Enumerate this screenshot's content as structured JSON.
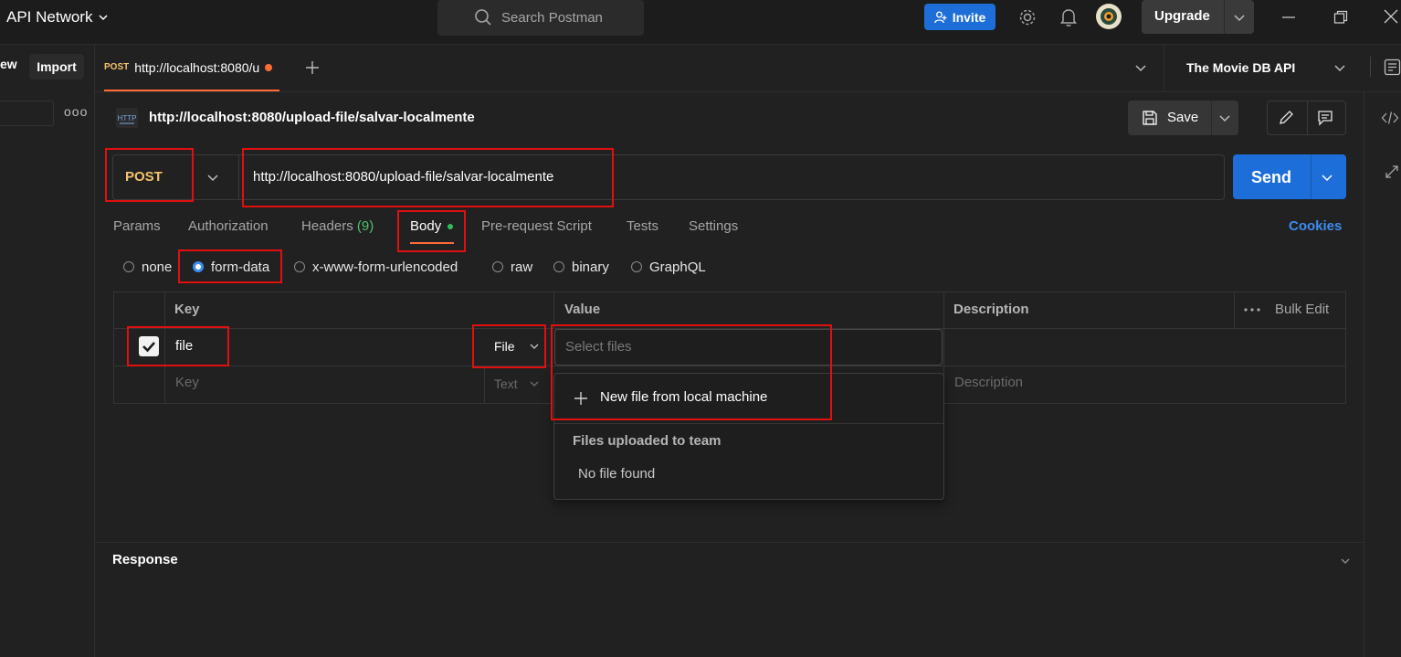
{
  "topbar": {
    "workspace": "API Network",
    "search_placeholder": "Search Postman",
    "invite_label": "Invite",
    "upgrade_label": "Upgrade"
  },
  "sidebar": {
    "new_label": "ew",
    "import_label": "Import",
    "more": "ooo"
  },
  "tabs": {
    "active": {
      "method": "POST",
      "url": "http://localhost:8080/u"
    },
    "environment": "The Movie DB API"
  },
  "request": {
    "title": "http://localhost:8080/upload-file/salvar-localmente",
    "save_label": "Save",
    "method": "POST",
    "url": "http://localhost:8080/upload-file/salvar-localmente",
    "send_label": "Send"
  },
  "request_tabs": {
    "params": "Params",
    "authorization": "Authorization",
    "headers": "Headers",
    "headers_count": "(9)",
    "body": "Body",
    "prerequest": "Pre-request Script",
    "tests": "Tests",
    "settings": "Settings",
    "cookies": "Cookies"
  },
  "body_types": {
    "none": "none",
    "form_data": "form-data",
    "urlencoded": "x-www-form-urlencoded",
    "raw": "raw",
    "binary": "binary",
    "graphql": "GraphQL",
    "selected": "form-data"
  },
  "table": {
    "headers": {
      "key": "Key",
      "value": "Value",
      "description": "Description",
      "bulk_edit": "Bulk Edit"
    },
    "row": {
      "key": "file",
      "type": "File",
      "value_placeholder": "Select files"
    },
    "empty_row": {
      "key_placeholder": "Key",
      "type": "Text",
      "description_placeholder": "Description"
    }
  },
  "file_dropdown": {
    "new_file": "New file from local machine",
    "heading": "Files uploaded to team",
    "empty": "No file found"
  },
  "response": {
    "title": "Response"
  },
  "colors": {
    "accent": "#ff6c37",
    "primary": "#1d6ed8",
    "method": "#f5c26b",
    "highlight": "#e01010"
  }
}
